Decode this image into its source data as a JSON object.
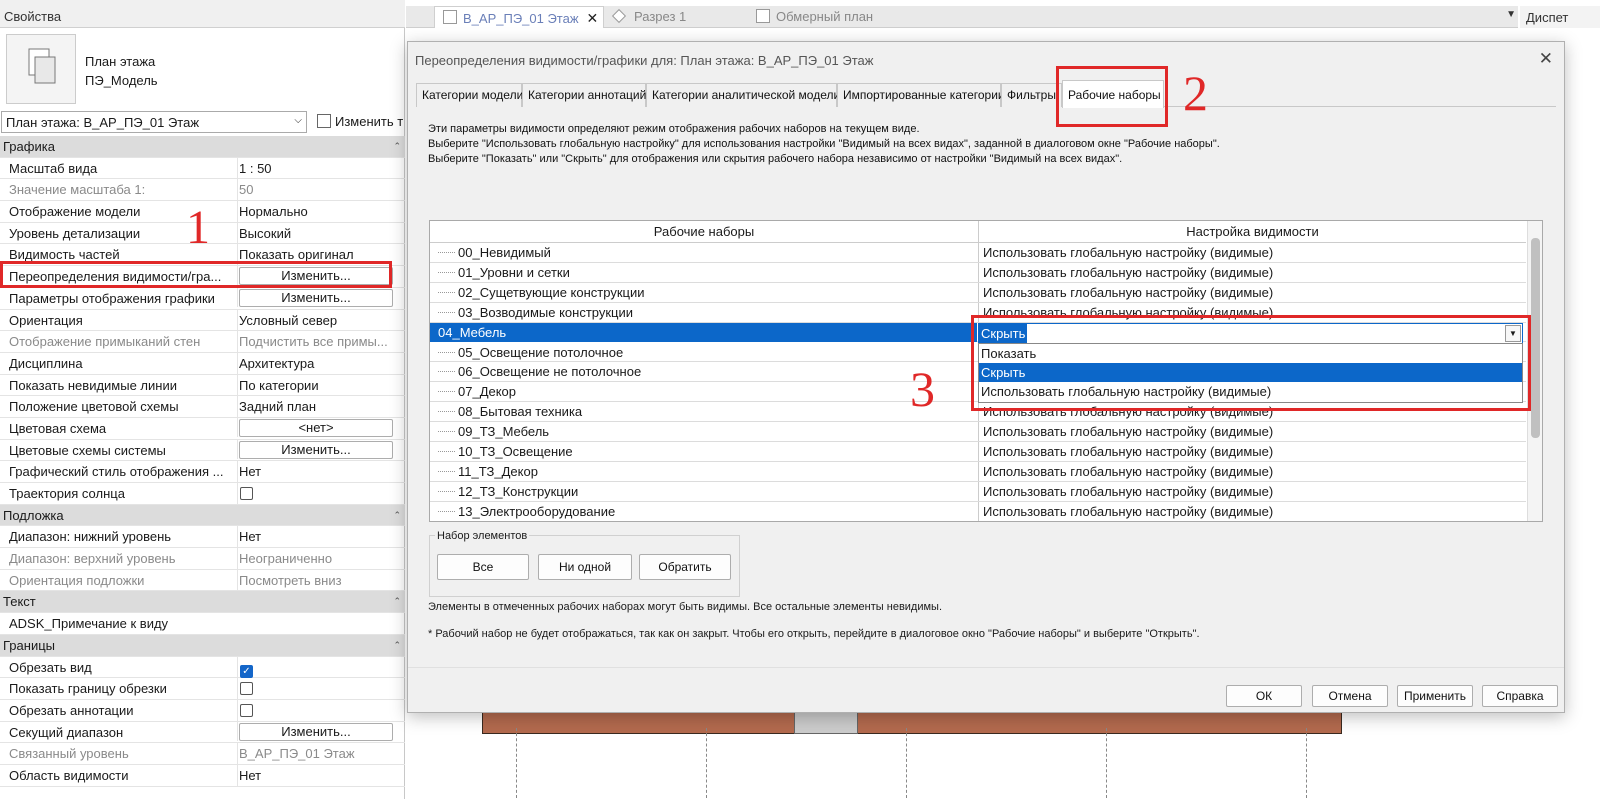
{
  "properties": {
    "title": "Свойства",
    "type_name_line1": "План этажа",
    "type_name_line2": "ПЭ_Модель",
    "type_selector": "План этажа: В_АР_ПЭ_01 Этаж",
    "edit_type": "Изменить т",
    "rows": [
      {
        "kind": "group",
        "name": "Графика",
        "toggle": "⌃"
      },
      {
        "name": "Масштаб вида",
        "value": "1 : 50"
      },
      {
        "name": "Значение масштаба    1:",
        "value": "50",
        "dim": true
      },
      {
        "name": "Отображение модели",
        "value": "Нормально"
      },
      {
        "name": "Уровень детализации",
        "value": "Высокий"
      },
      {
        "name": "Видимость частей",
        "value": "Показать оригинал"
      },
      {
        "name": "Переопределения видимости/гра...",
        "button": "Изменить..."
      },
      {
        "name": "Параметры отображения графики",
        "button": "Изменить..."
      },
      {
        "name": "Ориентация",
        "value": "Условный север"
      },
      {
        "name": "Отображение примыканий стен",
        "value": "Подчистить все примы...",
        "dim": true
      },
      {
        "name": "Дисциплина",
        "value": "Архитектура"
      },
      {
        "name": "Показать невидимые линии",
        "value": "По категории"
      },
      {
        "name": "Положение цветовой схемы",
        "value": "Задний план"
      },
      {
        "name": "Цветовая схема",
        "button": "<нет>"
      },
      {
        "name": "Цветовые схемы системы",
        "button": "Изменить..."
      },
      {
        "name": "Графический стиль отображения ...",
        "value": "Нет"
      },
      {
        "name": "Траектория солнца",
        "checkbox": false
      },
      {
        "kind": "group",
        "name": "Подложка",
        "toggle": "⌃"
      },
      {
        "name": "Диапазон: нижний уровень",
        "value": "Нет"
      },
      {
        "name": "Диапазон: верхний уровень",
        "value": "Неограниченно",
        "dim": true
      },
      {
        "name": "Ориентация подложки",
        "value": "Посмотреть вниз",
        "dim": true
      },
      {
        "kind": "group",
        "name": "Текст",
        "toggle": "⌃"
      },
      {
        "name": "ADSK_Примечание к виду",
        "value": ""
      },
      {
        "kind": "group",
        "name": "Границы",
        "toggle": "⌃"
      },
      {
        "name": "Обрезать вид",
        "checkbox": true
      },
      {
        "name": "Показать границу обрезки",
        "checkbox": false
      },
      {
        "name": "Обрезать аннотации",
        "checkbox": false
      },
      {
        "name": "Секущий диапазон",
        "button": "Изменить..."
      },
      {
        "name": "Связанный уровень",
        "value": "В_АР_ПЭ_01 Этаж",
        "dim": true
      },
      {
        "name": "Область видимости",
        "value": "Нет"
      }
    ]
  },
  "view_tabs": [
    {
      "label": "В_АР_ПЭ_01 Этаж",
      "active": true,
      "close": "✕"
    },
    {
      "label": "Разрез 1",
      "active": false
    },
    {
      "label": "Обмерный план",
      "active": false
    }
  ],
  "dispatcher": "Диспет",
  "dialog": {
    "title": "Переопределения видимости/графики для: План этажа: В_АР_ПЭ_01 Этаж",
    "close": "✕",
    "tabs": [
      "Категории модели",
      "Категории аннотаций",
      "Категории аналитической модели",
      "Импортированные категории",
      "Фильтры",
      "Рабочие наборы"
    ],
    "info": [
      "Эти параметры видимости определяют режим отображения рабочих наборов на текущем виде.",
      "Выберите \"Использовать глобальную настройку\" для использования настройки \"Видимый на всех видах\", заданной в диалоговом окне \"Рабочие наборы\".",
      "Выберите \"Показать\" или \"Скрыть\" для отображения или скрытия рабочего набора независимо от настройки \"Видимый на всех видах\"."
    ],
    "columns": [
      "Рабочие наборы",
      "Настройка видимости"
    ],
    "worksets": [
      {
        "name": "00_Невидимый",
        "vis": "Использовать глобальную настройку (видимые)"
      },
      {
        "name": "01_Уровни и сетки",
        "vis": "Использовать глобальную настройку (видимые)"
      },
      {
        "name": "02_Сущетвующие конструкции",
        "vis": "Использовать глобальную настройку (видимые)"
      },
      {
        "name": "03_Возводимые конструкции",
        "vis": "Использовать глобальную настройку (видимые)"
      },
      {
        "name": "04_Мебель",
        "vis": "",
        "selected": true
      },
      {
        "name": "05_Освещение потолочное",
        "vis": ""
      },
      {
        "name": "06_Освещение не потолочное",
        "vis": ""
      },
      {
        "name": "07_Декор",
        "vis": ""
      },
      {
        "name": "08_Бытовая техника",
        "vis": "Использовать глобальную настройку (видимые)"
      },
      {
        "name": "09_ТЗ_Мебель",
        "vis": "Использовать глобальную настройку (видимые)"
      },
      {
        "name": "10_ТЗ_Освещение",
        "vis": "Использовать глобальную настройку (видимые)"
      },
      {
        "name": "11_ТЗ_Декор",
        "vis": "Использовать глобальную настройку (видимые)"
      },
      {
        "name": "12_ТЗ_Конструкции",
        "vis": "Использовать глобальную настройку (видимые)"
      },
      {
        "name": "13_Электрооборудование",
        "vis": "Использовать глобальную настройку (видимые)"
      }
    ],
    "combo_value": "Скрыть",
    "dropdown_options": [
      {
        "label": "Показать",
        "highlight": false
      },
      {
        "label": "Скрыть",
        "highlight": true
      },
      {
        "label": "Использовать глобальную настройку (видимые)",
        "highlight": false
      }
    ],
    "set_group": "Набор элементов",
    "set_buttons": [
      "Все",
      "Ни одной",
      "Обратить"
    ],
    "note1": "Элементы в отмеченных рабочих наборах могут быть видимы.  Все остальные элементы невидимы.",
    "note2": "* Рабочий набор не будет отображаться, так как он закрыт. Чтобы его открыть, перейдите в диалоговое окно \"Рабочие наборы\" и выберите \"Открыть\".",
    "footer_buttons": [
      "ОК",
      "Отмена",
      "Применить",
      "Справка"
    ]
  },
  "annotations": [
    "1",
    "2",
    "3"
  ],
  "colors": {
    "accent": "#0c67c9",
    "annotation": "#e02828",
    "wall": "#b36a4e"
  }
}
